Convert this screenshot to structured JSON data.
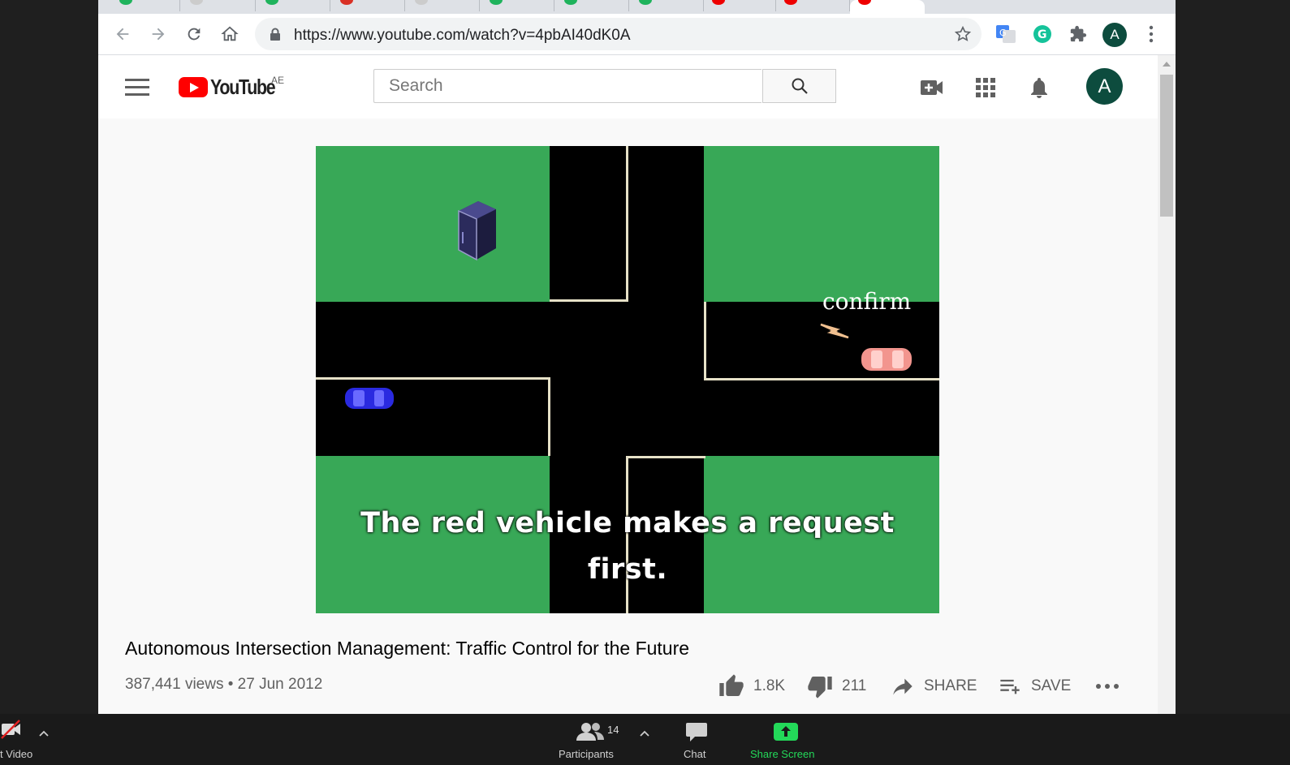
{
  "browser": {
    "url": "https://www.youtube.com/watch?v=4pbAI40dK0A",
    "profile_initial": "A"
  },
  "youtube": {
    "logo_text": "YouTube",
    "region": "AE",
    "search_placeholder": "Search",
    "avatar_initial": "A"
  },
  "video": {
    "caption_line1": "The red vehicle makes a request",
    "caption_line2": "first.",
    "overlay_label": "confirm",
    "title": "Autonomous Intersection Management: Traffic Control for the Future",
    "meta": "387,441 views • 27 Jun 2012",
    "likes": "1.8K",
    "dislikes": "211",
    "share_label": "SHARE",
    "save_label": "SAVE"
  },
  "zoom": {
    "participants_count": "14",
    "participants_label": "Participants",
    "chat_label": "Chat",
    "share_screen_label": "Share Screen",
    "video_label": "t Video"
  },
  "colors": {
    "youtube_red": "#ff0000",
    "grass": "#38a857",
    "avatar": "#0d4c3e",
    "share_green": "#23d959"
  }
}
